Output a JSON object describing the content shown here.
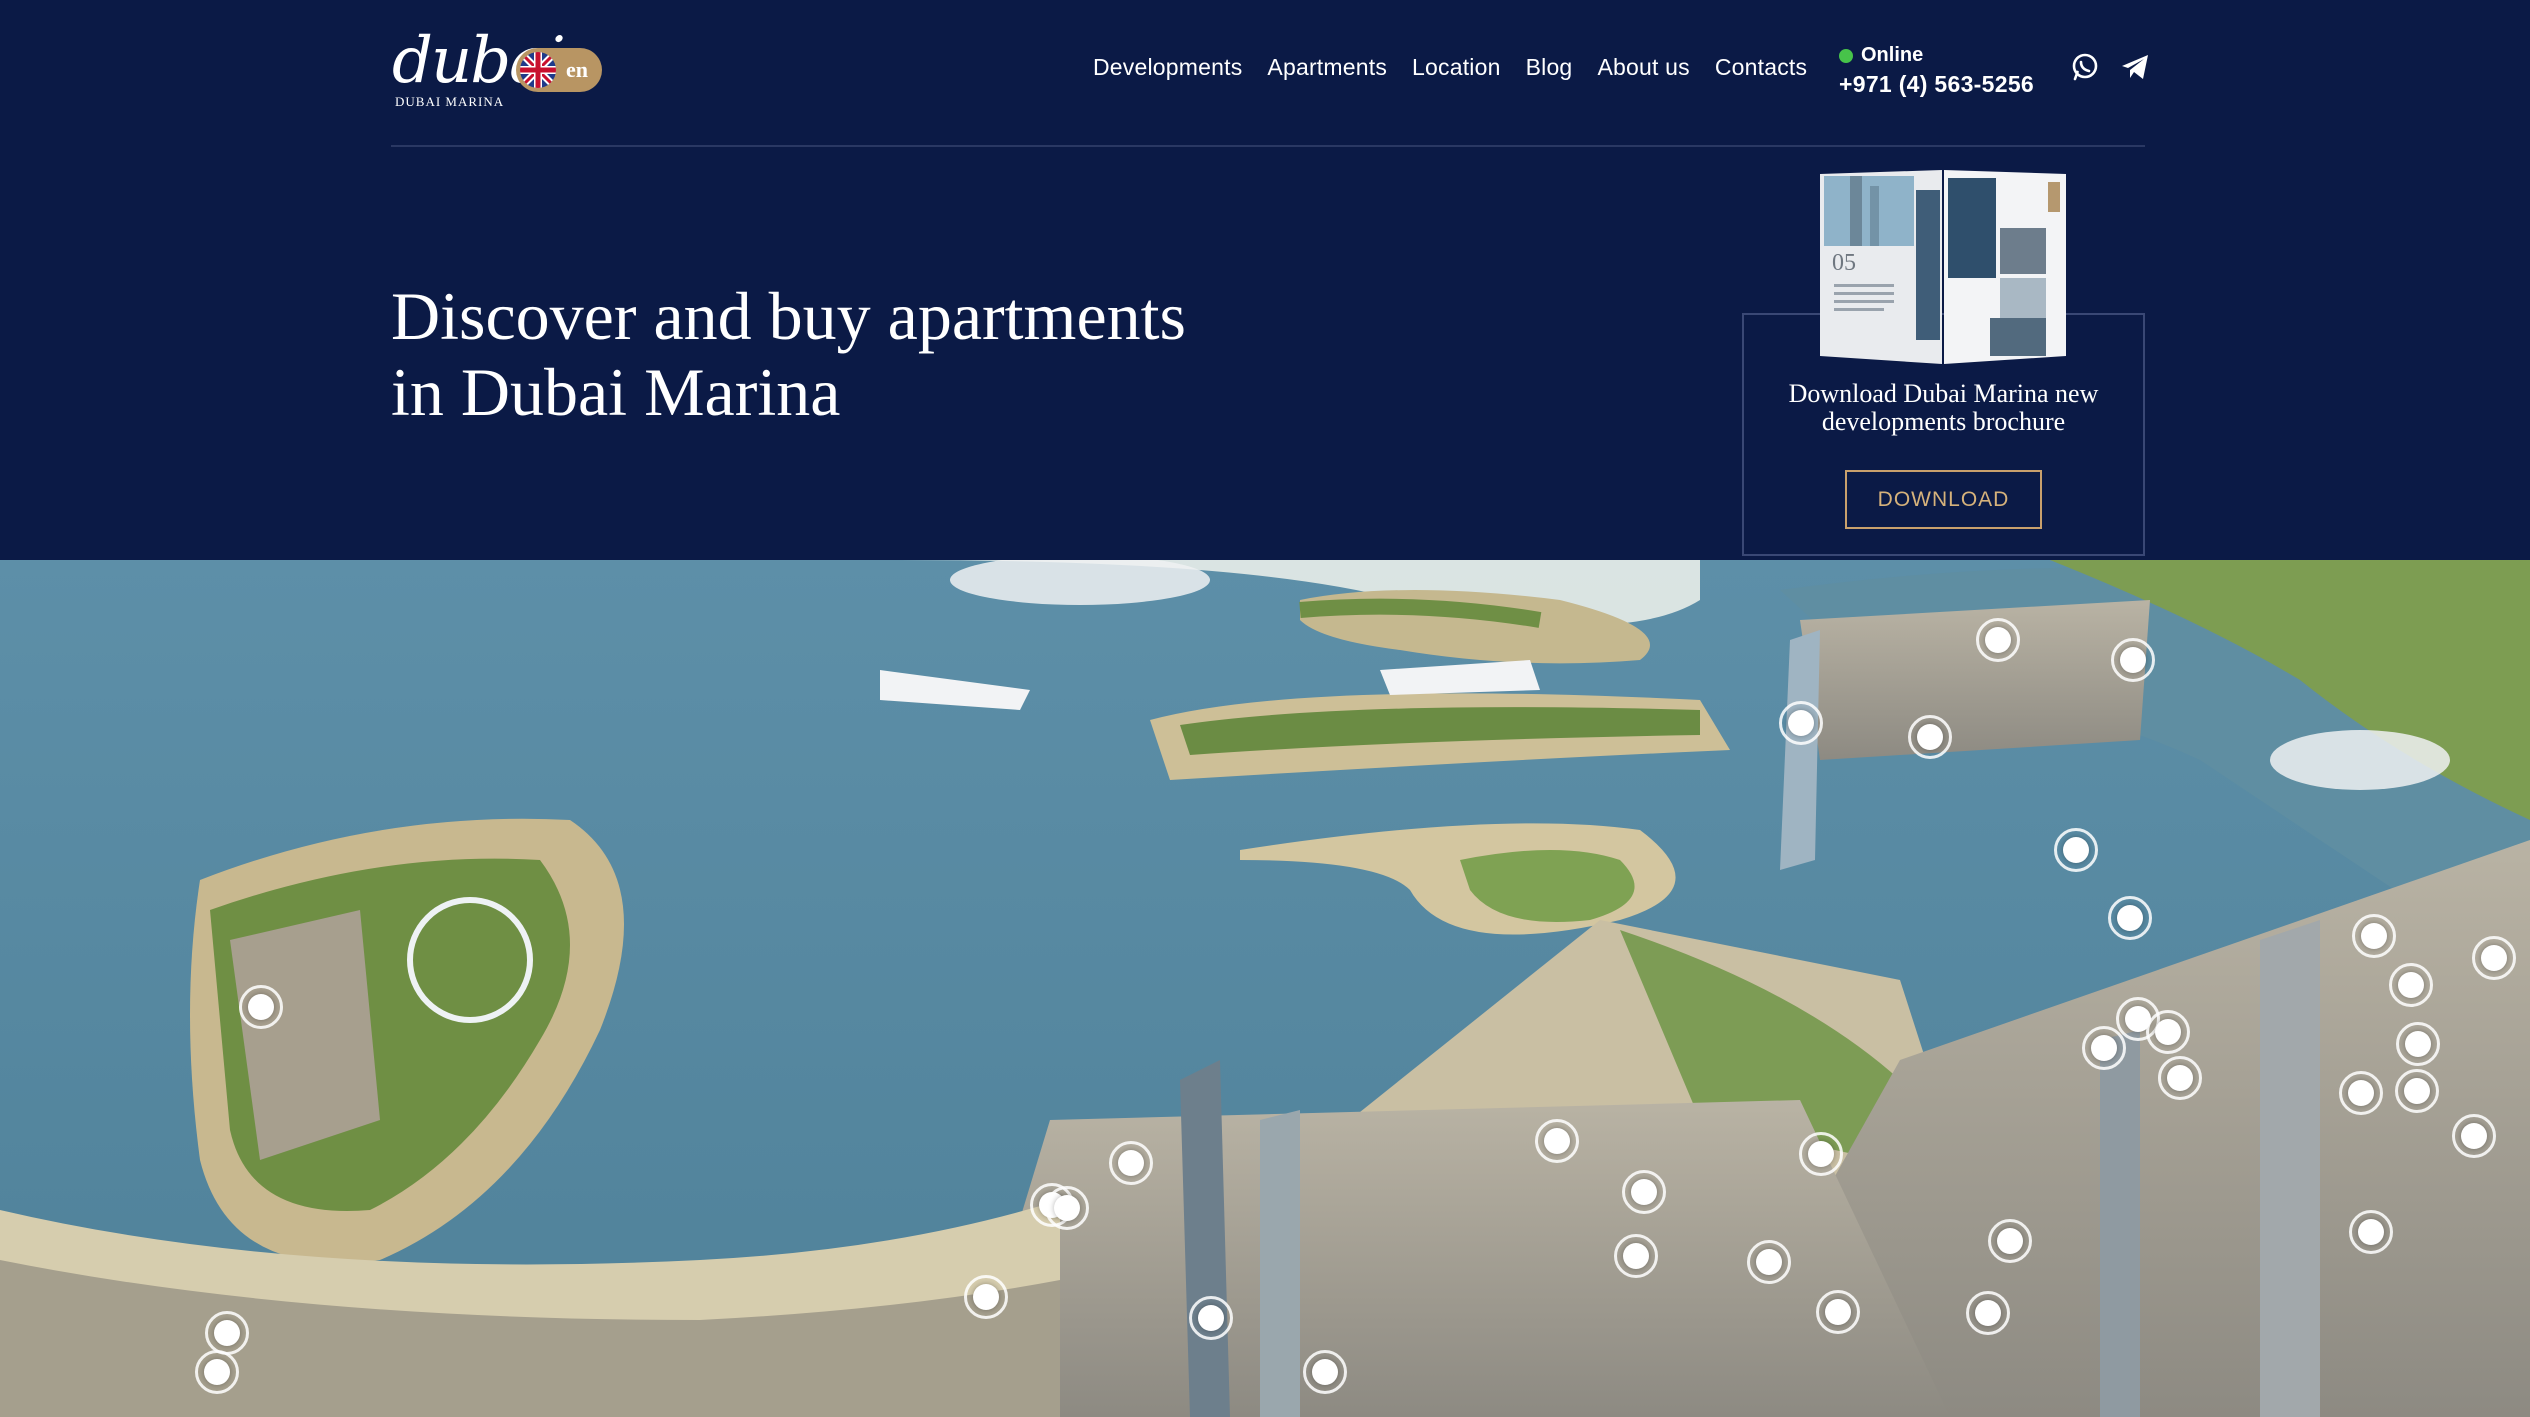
{
  "brand": {
    "wordmark": "dubai",
    "subtitle": "DUBAI MARINA"
  },
  "language": {
    "code": "en",
    "flag": "uk-flag-icon"
  },
  "nav": {
    "items": [
      {
        "label": "Developments"
      },
      {
        "label": "Apartments"
      },
      {
        "label": "Location"
      },
      {
        "label": "Blog"
      },
      {
        "label": "About us"
      },
      {
        "label": "Contacts"
      }
    ]
  },
  "contact": {
    "status": "Online",
    "status_color": "#47c34a",
    "phone": "+971 (4) 563-5256",
    "icons": [
      "whatsapp-icon",
      "telegram-icon"
    ]
  },
  "hero": {
    "title_line1": "Discover and buy apartments",
    "title_line2": "in Dubai Marina"
  },
  "brochure": {
    "text_line1": "Download Dubai Marina new",
    "text_line2": "developments brochure",
    "button": "DOWNLOAD",
    "page_number": "05"
  },
  "colors": {
    "background": "#0b1a46",
    "accent": "#c9a06c",
    "lang_pill": "#b89563"
  }
}
